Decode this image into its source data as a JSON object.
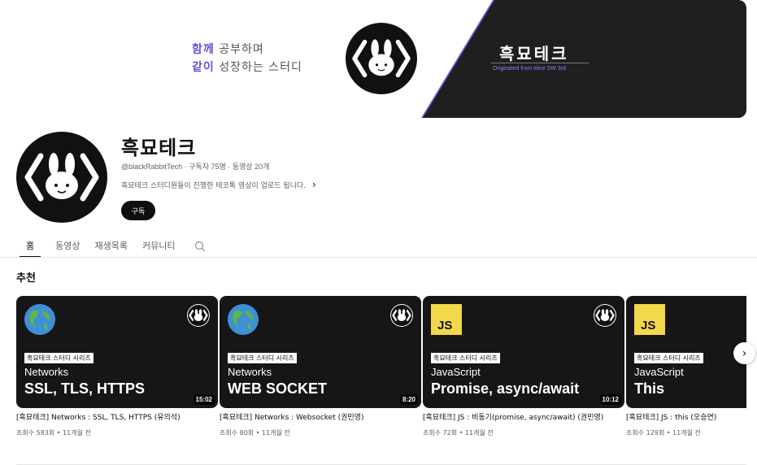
{
  "banner": {
    "tagline_line1_accent": "함께",
    "tagline_line1_rest": " 공부하며",
    "tagline_line2_accent": "같이",
    "tagline_line2_rest": " 성장하는 스터디",
    "title": "흑묘테크",
    "subtitle": "Originated from elice SW 3rd",
    "accent_color": "#7b52e6"
  },
  "channel": {
    "name": "흑묘테크",
    "meta": "@blackRabbitTech · 구독자 75명 · 동영상 20개",
    "description": "흑묘테크 스터디원들이 진행한 테코톡 영상이 업로드 됩니다.",
    "subscribe_label": "구독"
  },
  "tabs": [
    {
      "label": "홈"
    },
    {
      "label": "동영상"
    },
    {
      "label": "재생목록"
    },
    {
      "label": "커뮤니티"
    }
  ],
  "section": {
    "title": "추천"
  },
  "videos": [
    {
      "icon": "globe-icon",
      "series": "흑묘테크 스터디 시리즈",
      "topic": "Networks",
      "headline": "SSL, TLS, HTTPS",
      "duration": "15:02",
      "title": "[흑묘테크] Networks : SSL, TLS, HTTPS (유의석)",
      "meta": "조회수 583회 • 11개월 전"
    },
    {
      "icon": "globe-icon",
      "series": "흑묘테크 스터디 시리즈",
      "topic": "Networks",
      "headline": "WEB SOCKET",
      "duration": "8:20",
      "title": "[흑묘테크] Networks : Websocket (권민영)",
      "meta": "조회수 80회 • 11개월 전"
    },
    {
      "icon": "js-icon",
      "series": "흑묘테크 스터디 시리즈",
      "topic": "JavaScript",
      "headline": "Promise, async/await",
      "duration": "10:12",
      "title": "[흑묘테크] JS : 비동기(promise, async/await) (권민영)",
      "meta": "조회수 72회 • 11개월 전"
    },
    {
      "icon": "js-icon",
      "series": "흑묘테크 스터디 시리즈",
      "topic": "JavaScript",
      "headline": "This",
      "duration": "",
      "title": "[흑묘테크] JS : this (오승연)",
      "meta": "조회수 129회 • 11개월 전"
    }
  ],
  "js_label": "JS",
  "next_glyph": "›",
  "desc_chevron": "›"
}
